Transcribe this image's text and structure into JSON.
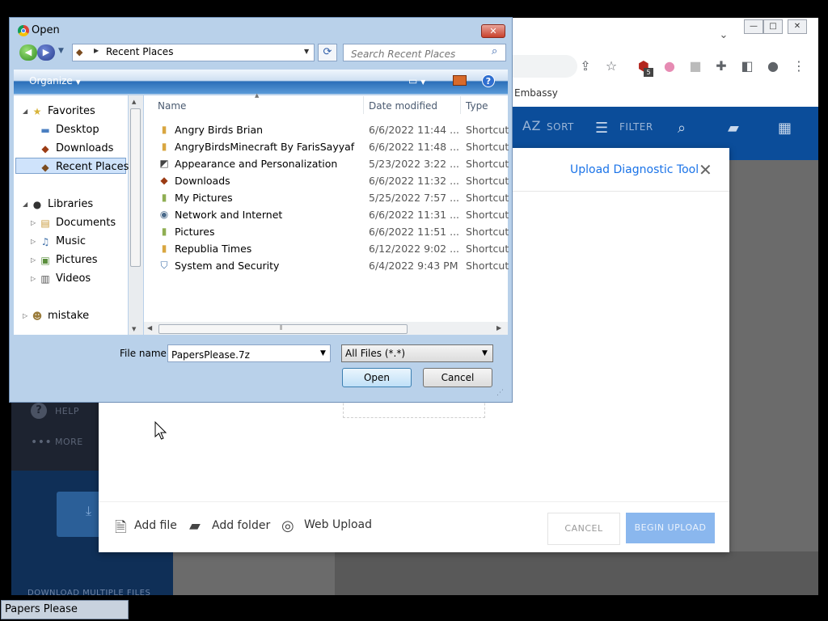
{
  "browser": {
    "bookmark": "Embassy",
    "toolbar_icons": [
      "share-icon",
      "star-icon",
      "extension-icon",
      "flag-icon",
      "puzzle-icon",
      "sidepanel-icon",
      "profile-icon",
      "menu-icon"
    ],
    "ext_badge": "5"
  },
  "app": {
    "header": {
      "sort": "SORT",
      "filter": "FILTER",
      "sort_icon": "AZ"
    },
    "sidebar": {
      "help": "HELP",
      "more": "MORE",
      "download": "DOWNLOAD MULTIPLE FILES"
    },
    "modal": {
      "diagnostic_link": "Upload Diagnostic Tool",
      "add_file": "Add file",
      "add_folder": "Add folder",
      "web_upload": "Web Upload",
      "cancel": "CANCEL",
      "begin_upload": "BEGIN UPLOAD"
    }
  },
  "dialog": {
    "title": "Open",
    "address": "Recent Places",
    "search_placeholder": "Search Recent Places",
    "organize": "Organize",
    "nav": {
      "favorites": "Favorites",
      "desktop": "Desktop",
      "downloads": "Downloads",
      "recent": "Recent Places",
      "libraries": "Libraries",
      "documents": "Documents",
      "music": "Music",
      "pictures": "Pictures",
      "videos": "Videos",
      "mistake": "mistake"
    },
    "columns": {
      "name": "Name",
      "date": "Date modified",
      "type": "Type"
    },
    "files": [
      {
        "name": "Angry Birds Brian",
        "date": "6/6/2022 11:44 ...",
        "type": "Shortcut"
      },
      {
        "name": "AngryBirdsMinecraft By FarisSayyaf",
        "date": "6/6/2022 11:48 ...",
        "type": "Shortcut"
      },
      {
        "name": "Appearance and Personalization",
        "date": "5/23/2022 3:22 ...",
        "type": "Shortcut"
      },
      {
        "name": "Downloads",
        "date": "6/6/2022 11:32 ...",
        "type": "Shortcut"
      },
      {
        "name": "My Pictures",
        "date": "5/25/2022 7:57 ...",
        "type": "Shortcut"
      },
      {
        "name": "Network and Internet",
        "date": "6/6/2022 11:31 ...",
        "type": "Shortcut"
      },
      {
        "name": "Pictures",
        "date": "6/6/2022 11:51 ...",
        "type": "Shortcut"
      },
      {
        "name": "Republia Times",
        "date": "6/12/2022 9:02 ...",
        "type": "Shortcut"
      },
      {
        "name": "System and Security",
        "date": "6/4/2022 9:43 PM",
        "type": "Shortcut"
      }
    ],
    "filename_label": "File name:",
    "filename_value": "PapersPlease.7z",
    "filetype": "All Files (*.*)",
    "open": "Open",
    "cancel": "Cancel"
  },
  "taskbar": {
    "item": "Papers Please"
  }
}
